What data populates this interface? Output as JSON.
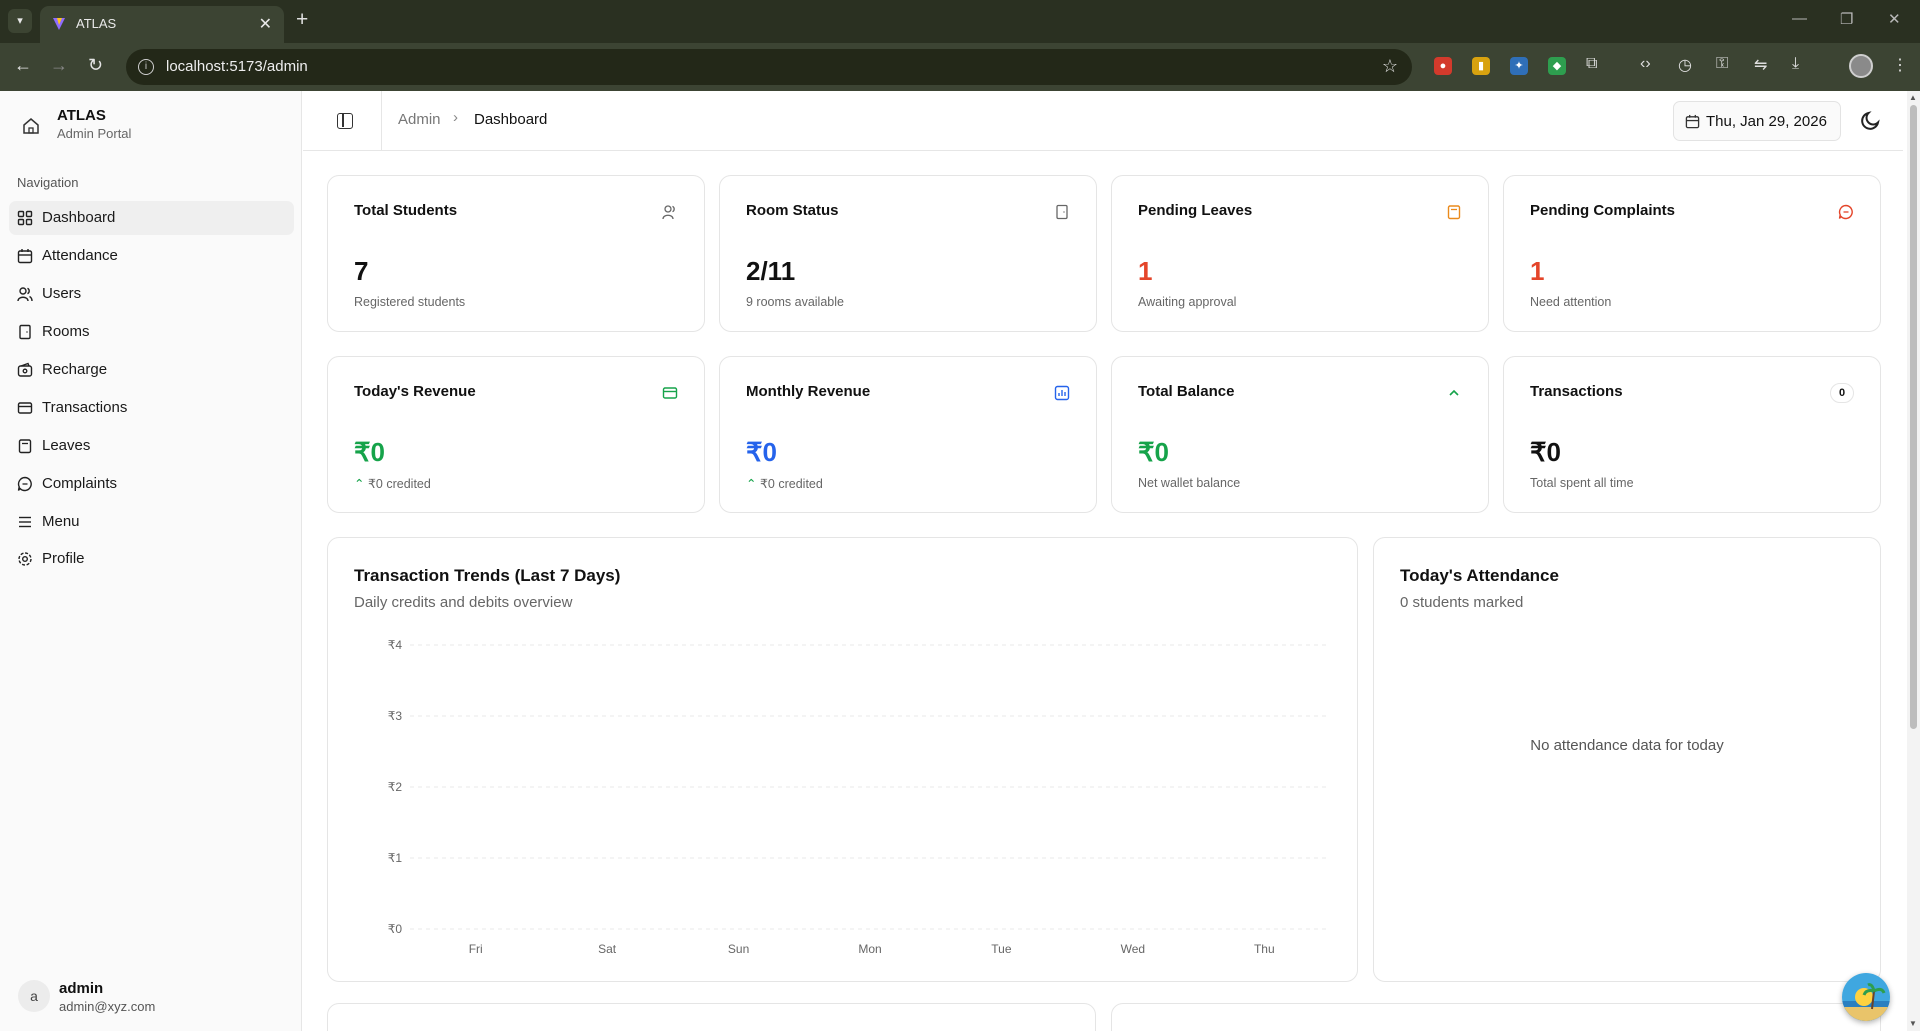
{
  "browser": {
    "tab_title": "ATLAS",
    "url": "localhost:5173/admin"
  },
  "sidebar": {
    "brand_name": "ATLAS",
    "brand_sub": "Admin Portal",
    "nav_label": "Navigation",
    "items": [
      {
        "label": "Dashboard",
        "icon": "dashboard-grid-icon",
        "active": true
      },
      {
        "label": "Attendance",
        "icon": "calendar-icon"
      },
      {
        "label": "Users",
        "icon": "users-icon"
      },
      {
        "label": "Rooms",
        "icon": "door-icon"
      },
      {
        "label": "Recharge",
        "icon": "wallet-icon"
      },
      {
        "label": "Transactions",
        "icon": "card-icon"
      },
      {
        "label": "Leaves",
        "icon": "clipboard-icon"
      },
      {
        "label": "Complaints",
        "icon": "message-icon"
      },
      {
        "label": "Menu",
        "icon": "menu-icon"
      },
      {
        "label": "Profile",
        "icon": "gear-icon"
      }
    ],
    "user": {
      "initial": "a",
      "name": "admin",
      "email": "admin@xyz.com"
    }
  },
  "header": {
    "breadcrumb_parent": "Admin",
    "breadcrumb_current": "Dashboard",
    "date_label": "Thu, Jan 29, 2026"
  },
  "cards": {
    "total_students": {
      "title": "Total Students",
      "value": "7",
      "sub": "Registered students"
    },
    "room_status": {
      "title": "Room Status",
      "value": "2/11",
      "sub": "9 rooms available"
    },
    "pending_leaves": {
      "title": "Pending Leaves",
      "value": "1",
      "sub": "Awaiting approval"
    },
    "pending_complaints": {
      "title": "Pending Complaints",
      "value": "1",
      "sub": "Need attention"
    },
    "todays_revenue": {
      "title": "Today's Revenue",
      "value": "₹0",
      "sub": "₹0 credited"
    },
    "monthly_revenue": {
      "title": "Monthly Revenue",
      "value": "₹0",
      "sub": "₹0 credited"
    },
    "total_balance": {
      "title": "Total Balance",
      "value": "₹0",
      "sub": "Net wallet balance"
    },
    "transactions": {
      "title": "Transactions",
      "value": "₹0",
      "sub": "Total spent all time",
      "badge": "0"
    }
  },
  "trends": {
    "title": "Transaction Trends (Last 7 Days)",
    "subtitle": "Daily credits and debits overview"
  },
  "attendance": {
    "title": "Today's Attendance",
    "subtitle": "0 students marked",
    "empty": "No attendance data for today"
  },
  "colors": {
    "accent_red": "#e4452a",
    "accent_green": "#16a34a",
    "accent_blue": "#2563eb"
  },
  "chart_data": {
    "type": "line",
    "categories": [
      "Fri",
      "Sat",
      "Sun",
      "Mon",
      "Tue",
      "Wed",
      "Thu"
    ],
    "y_ticks": [
      "₹0",
      "₹1",
      "₹2",
      "₹3",
      "₹4"
    ],
    "ylim": [
      0,
      4
    ],
    "grid": true,
    "series": []
  }
}
